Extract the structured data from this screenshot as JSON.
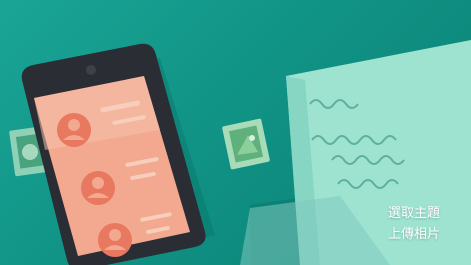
{
  "banner": {
    "menu": {
      "choose_theme": "選取主題",
      "upload_photo": "上傳相片"
    },
    "illustration_icons": [
      "phone-icon",
      "contact-avatar-icon",
      "postage-stamp-icon",
      "letter-icon"
    ]
  }
}
